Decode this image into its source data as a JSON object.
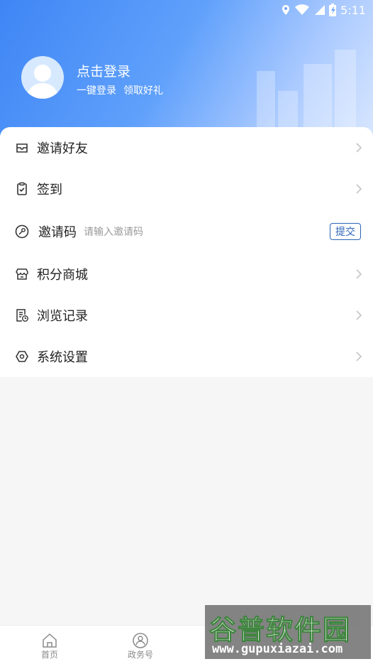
{
  "status_bar": {
    "time": "5:11"
  },
  "profile": {
    "title": "点击登录",
    "sub_left": "一键登录",
    "sub_right": "领取好礼"
  },
  "menu": {
    "invite_friends": "邀请好友",
    "check_in": "签到",
    "invite_code": {
      "label": "邀请码",
      "placeholder": "请输入邀请码",
      "submit": "提交"
    },
    "points_mall": "积分商城",
    "history": "浏览记录",
    "settings": "系统设置"
  },
  "tabbar": [
    {
      "label": "首页"
    },
    {
      "label": "政务号"
    }
  ],
  "watermark": {
    "title": "谷普软件园",
    "url": "www.gupuxiazai.com"
  },
  "colors": {
    "header": "#3f86f5",
    "submit_border": "#2c63b8",
    "background": "#f6f6f6"
  },
  "icons": [
    "location-icon",
    "wifi-icon",
    "signal-icon",
    "battery-icon",
    "avatar-icon",
    "chevron-right-icon",
    "home-icon",
    "government-icon"
  ]
}
